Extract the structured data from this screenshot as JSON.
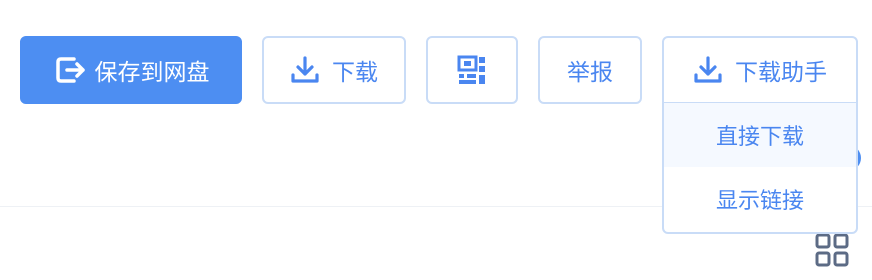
{
  "toolbar": {
    "save_label": "保存到网盘",
    "download_label": "下载",
    "report_label": "举报",
    "helper_label": "下载助手"
  },
  "icons": {
    "save": "export-icon",
    "download": "download-icon",
    "qr": "qr-code-icon",
    "helper": "download-icon",
    "grid": "grid-icon"
  },
  "dropdown": {
    "items": [
      {
        "label": "直接下载",
        "highlighted": true
      },
      {
        "label": "显示链接",
        "highlighted": false
      }
    ]
  },
  "colors": {
    "primary": "#4d8ef2",
    "primary_text": "#ffffff",
    "link_text": "#4a86f0",
    "border": "#c9dcf7",
    "hover_bg": "#f5f9ff",
    "grid_icon": "#5c6b85"
  }
}
